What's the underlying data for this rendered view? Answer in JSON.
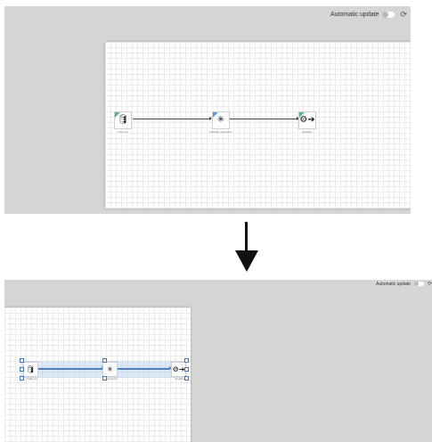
{
  "toolbar": {
    "label": "Automatic update",
    "refresh_icon": "refresh-icon",
    "toggle_state": "off"
  },
  "workflow": {
    "nodes": [
      {
        "label": "Data set",
        "icon": "database-icon"
      },
      {
        "label": "Multiple regression",
        "icon": "network-icon"
      },
      {
        "label": "Analysis",
        "icon": "gear-arrow-icon"
      }
    ]
  },
  "bottom_nodes": [
    {
      "label": "Data set"
    },
    {
      "label": "regression"
    },
    {
      "label": "Analysis"
    }
  ],
  "colors": {
    "panel": "#d4d5d5",
    "accent_green": "#5db38a",
    "accent_blue": "#5a9bd5",
    "selection_blue": "#4a80c8"
  }
}
